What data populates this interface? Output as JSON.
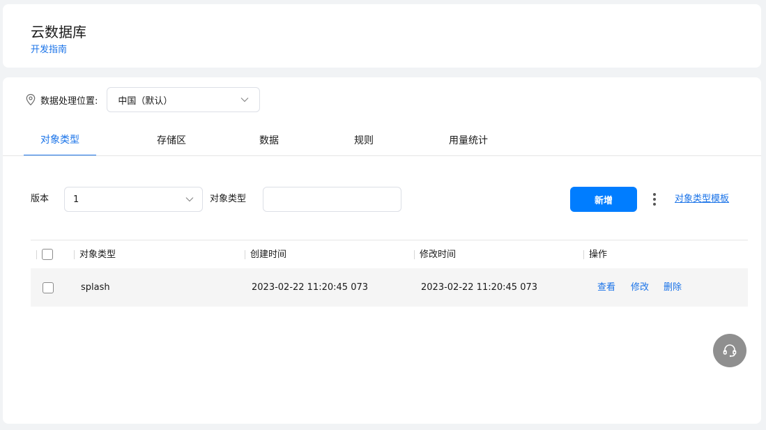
{
  "header": {
    "title": "云数据库",
    "guide_link": "开发指南"
  },
  "location": {
    "label": "数据处理位置:",
    "selected": "中国（默认）"
  },
  "tabs": [
    {
      "label": "对象类型",
      "active": true
    },
    {
      "label": "存储区",
      "active": false
    },
    {
      "label": "数据",
      "active": false
    },
    {
      "label": "规则",
      "active": false
    },
    {
      "label": "用量统计",
      "active": false
    }
  ],
  "filters": {
    "version_label": "版本",
    "version_value": "1",
    "type_label": "对象类型",
    "type_value": "",
    "add_button": "新增",
    "template_link": "对象类型模板"
  },
  "table": {
    "columns": [
      "对象类型",
      "创建时间",
      "修改时间",
      "操作"
    ],
    "rows": [
      {
        "object_type": "splash",
        "created": "2023-02-22 11:20:45 073",
        "modified": "2023-02-22 11:20:45 073",
        "actions": [
          "查看",
          "修改",
          "删除"
        ]
      }
    ]
  },
  "colors": {
    "primary": "#007dff",
    "link": "#1a73e8",
    "support_bg": "#8f8f8f"
  },
  "icons": {
    "location": "location-pin-icon",
    "chevron": "chevron-down-icon",
    "more": "more-vertical-icon",
    "support": "headset-icon"
  }
}
